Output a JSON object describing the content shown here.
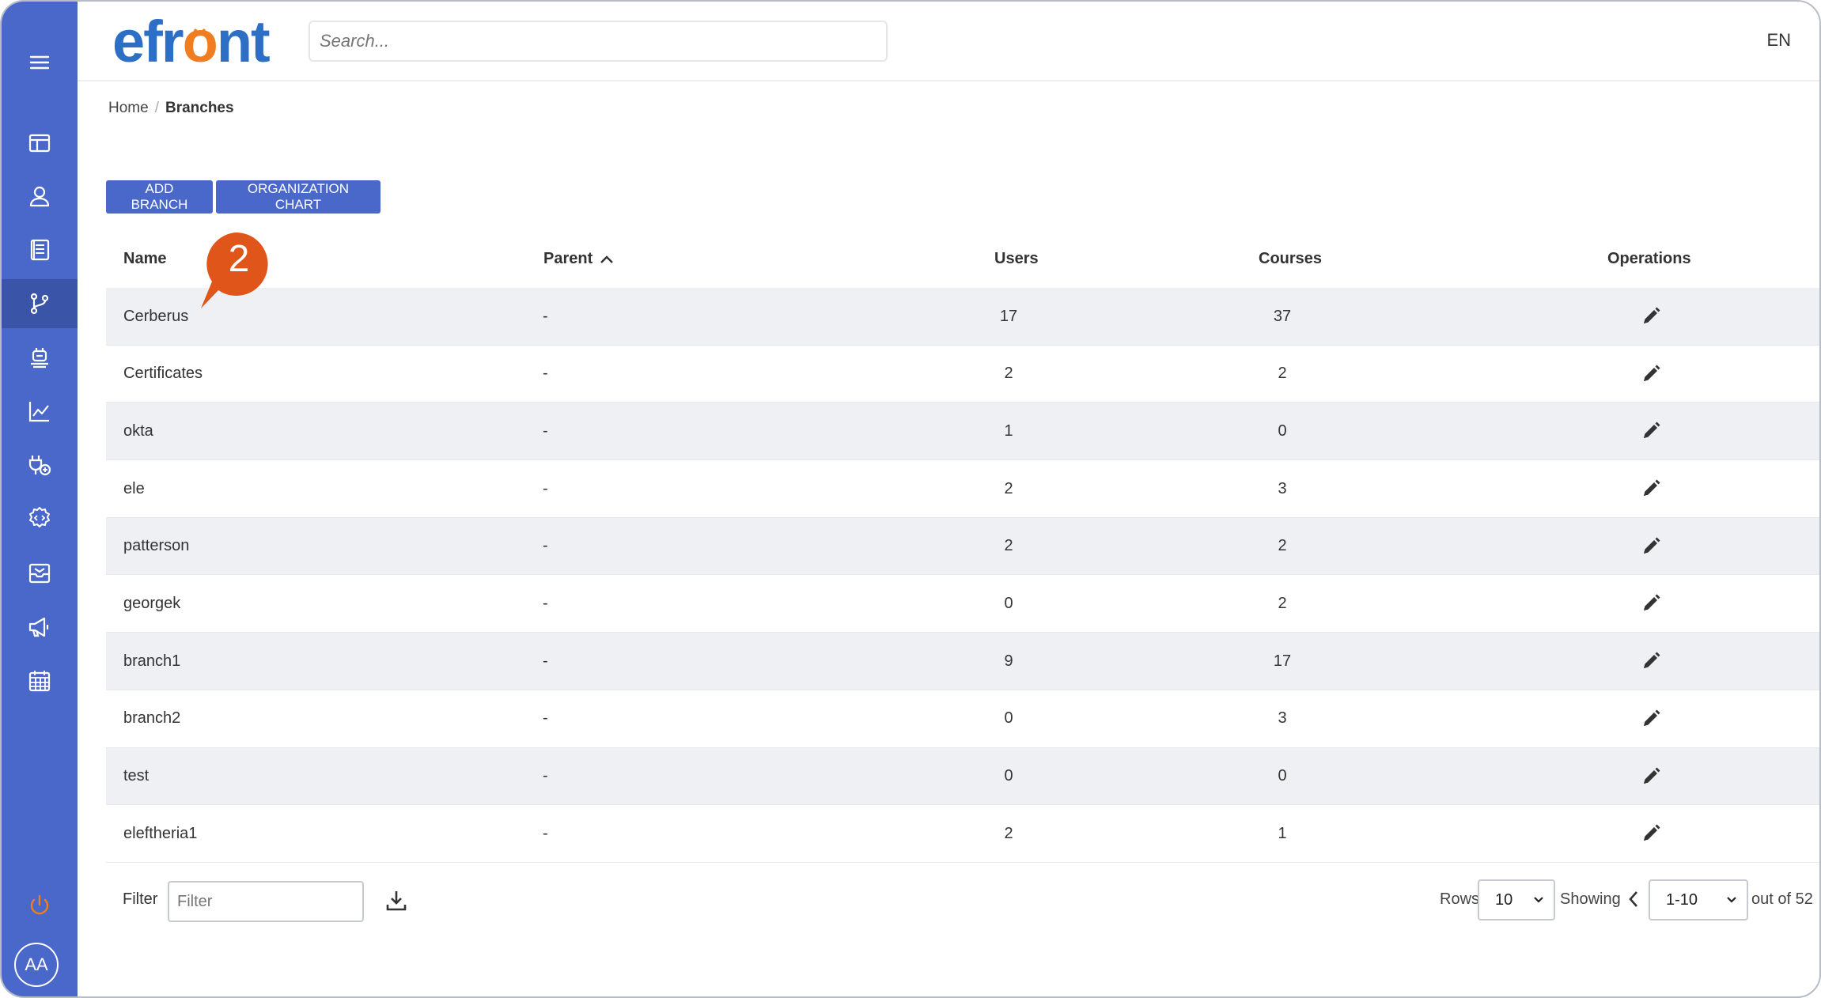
{
  "app": {
    "logo_text_pre": "efr",
    "logo_text_o": "o",
    "logo_text_post": "nt",
    "brand_color": "#4a68c9",
    "accent_color": "#f07d1f"
  },
  "topbar": {
    "search_placeholder": "Search...",
    "language": "EN"
  },
  "sidebar": {
    "items": [
      {
        "icon": "menu-icon"
      },
      {
        "icon": "dashboard-icon"
      },
      {
        "icon": "users-icon"
      },
      {
        "icon": "courses-icon"
      },
      {
        "icon": "branches-icon",
        "active": true
      },
      {
        "icon": "groups-icon"
      },
      {
        "icon": "reports-icon"
      },
      {
        "icon": "plugins-icon"
      },
      {
        "icon": "settings-icon"
      },
      {
        "icon": "inbox-icon"
      },
      {
        "icon": "announcements-icon"
      },
      {
        "icon": "calendar-icon"
      },
      {
        "icon": "power-icon"
      }
    ],
    "avatar_initials": "AA"
  },
  "breadcrumb": {
    "home": "Home",
    "separator": "/",
    "current": "Branches"
  },
  "toolbar": {
    "add_branch": "ADD BRANCH",
    "org_chart": "ORGANIZATION CHART"
  },
  "table": {
    "headers": {
      "name": "Name",
      "parent": "Parent",
      "users": "Users",
      "courses": "Courses",
      "operations": "Operations"
    },
    "rows": [
      {
        "name": "Cerberus",
        "parent": "-",
        "users": "17",
        "courses": "37"
      },
      {
        "name": "Certificates",
        "parent": "-",
        "users": "2",
        "courses": "2"
      },
      {
        "name": "okta",
        "parent": "-",
        "users": "1",
        "courses": "0"
      },
      {
        "name": "ele",
        "parent": "-",
        "users": "2",
        "courses": "3"
      },
      {
        "name": "patterson",
        "parent": "-",
        "users": "2",
        "courses": "2"
      },
      {
        "name": "georgek",
        "parent": "-",
        "users": "0",
        "courses": "2"
      },
      {
        "name": "branch1",
        "parent": "-",
        "users": "9",
        "courses": "17"
      },
      {
        "name": "branch2",
        "parent": "-",
        "users": "0",
        "courses": "3"
      },
      {
        "name": "test",
        "parent": "-",
        "users": "0",
        "courses": "0"
      },
      {
        "name": "eleftheria1",
        "parent": "-",
        "users": "2",
        "courses": "1"
      }
    ]
  },
  "footer": {
    "filter_label": "Filter",
    "filter_placeholder": "Filter",
    "rows_label": "Rows",
    "rows_value": "10",
    "showing_label": "Showing",
    "range_value": "1-10",
    "out_of": "out of 52"
  },
  "callout": {
    "number": "2",
    "color": "#e0561a"
  }
}
